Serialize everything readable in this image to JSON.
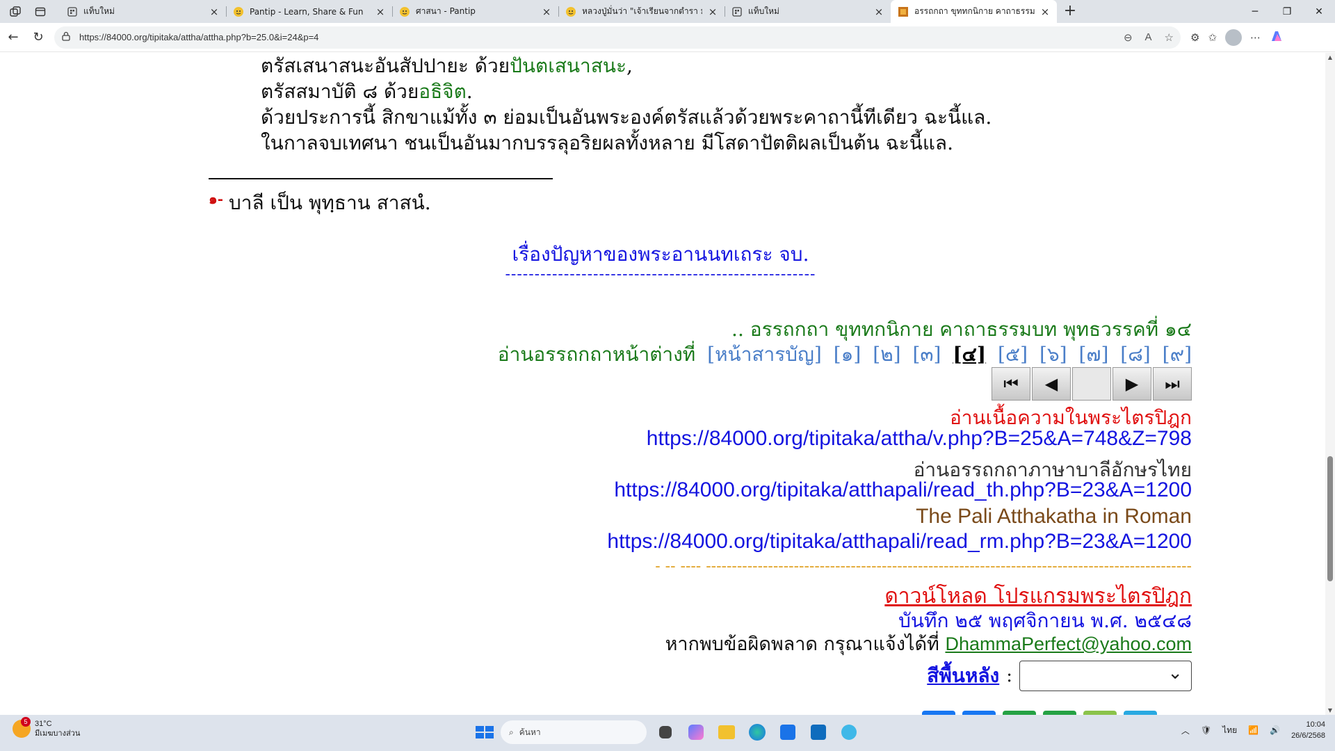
{
  "browser": {
    "tabs": [
      {
        "title": "แท็บใหม่",
        "icon": "new-tab-page-icon",
        "active": false
      },
      {
        "title": "Pantip - Learn, Share & Fun",
        "icon": "pantip-icon",
        "active": false
      },
      {
        "title": "ศาสนา - Pantip",
        "icon": "pantip-icon",
        "active": false
      },
      {
        "title": "หลวงปู่มั่นว่า \"เจ้าเรียนจากตำรา มันเป็น...",
        "icon": "pantip-icon",
        "active": false
      },
      {
        "title": "แท็บใหม่",
        "icon": "new-tab-page-icon",
        "active": false
      },
      {
        "title": "อรรถกถา ขุททกนิกาย คาถาธรรมบท พ...",
        "icon": "site-84000-icon",
        "active": true
      }
    ],
    "new_tab": "+",
    "url": "https://84000.org/tipitaka/attha/attha.php?b=25.0&i=24&p=4"
  },
  "content": {
    "line1_pre": "ตรัสเสนาสนะอันสัปปายะ ด้วย",
    "line1_green": "ปันตเสนาสนะ",
    "line1_post": ",",
    "line2_pre": "ตรัสสมาบัติ ๘ ด้วย",
    "line2_green": "อธิจิต",
    "line2_post": ".",
    "line3": "ด้วยประการนี้ สิกขาแม้ทั้ง ๓ ย่อมเป็นอันพระองค์ตรัสแล้วด้วยพระคาถานี้ทีเดียว ฉะนี้แล.",
    "line4": "ในกาลจบเทศนา ชนเป็นอันมากบรรลุอริยผลทั้งหลาย มีโสดาปัตติผลเป็นต้น ฉะนี้แล.",
    "footnote_mark": "๑-",
    "footnote_text": "บาลี เป็น พุทฺธาน สาสนํ.",
    "story_end": "เรื่องปัญหาของพระอานนทเถระ จบ.",
    "story_dash": "-----------------------------------------------------"
  },
  "nav": {
    "breadcrumb": ".. อรรถกถา ขุททกนิกาย คาถาธรรมบท พุทธวรรคที่ ๑๔",
    "pages_label": "อ่านอรรถกถาหน้าต่างที่",
    "toc": "[หน้าสารบัญ]",
    "pages": [
      "[๑]",
      "[๒]",
      "[๓]",
      "[๔]",
      "[๕]",
      "[๖]",
      "[๗]",
      "[๘]",
      "[๙]"
    ],
    "current_page": "[๔]"
  },
  "links": {
    "tipitaka_label": "อ่านเนื้อความในพระไตรปิฎก",
    "tipitaka_url": "https://84000.org/tipitaka/attha/v.php?B=25&A=748&Z=798",
    "pali_th_label": "อ่านอรรถกถาภาษาบาลีอักษรไทย",
    "pali_th_url": "https://84000.org/tipitaka/atthapali/read_th.php?B=23&A=1200",
    "roman_label": "The Pali Atthakatha in Roman",
    "roman_url": "https://84000.org/tipitaka/atthapali/read_rm.php?B=23&A=1200",
    "orange_dash": "- -- ---- ----------------------------------------------------------------------------------------------",
    "download": "ดาวน์โหลด โปรแกรมพระไตรปิฎก",
    "record_date": "บันทึก ๒๕ พฤศจิกายน พ.ศ. ๒๕๔๘",
    "contact_text": "หากพบข้อผิดพลาด กรุณาแจ้งได้ที่",
    "contact_email": "DhammaPerfect@yahoo.com",
    "bg_label": "สีพื้นหลัง",
    "bg_colon": ":"
  },
  "taskbar": {
    "weather_badge": "5",
    "temperature": "31°C",
    "weather_desc": "มีเมฆบางส่วน",
    "search_placeholder": "ค้นหา",
    "lang": "ไทย",
    "time": "10:04",
    "date": "26/6/2568"
  },
  "colors": {
    "green_text": "#1a7a1a",
    "blue_link": "#1414e0",
    "red_text": "#e01010",
    "page_link": "#4a7ec8",
    "orange_dash": "#e0a020",
    "brown_text": "#7a4a1a"
  }
}
